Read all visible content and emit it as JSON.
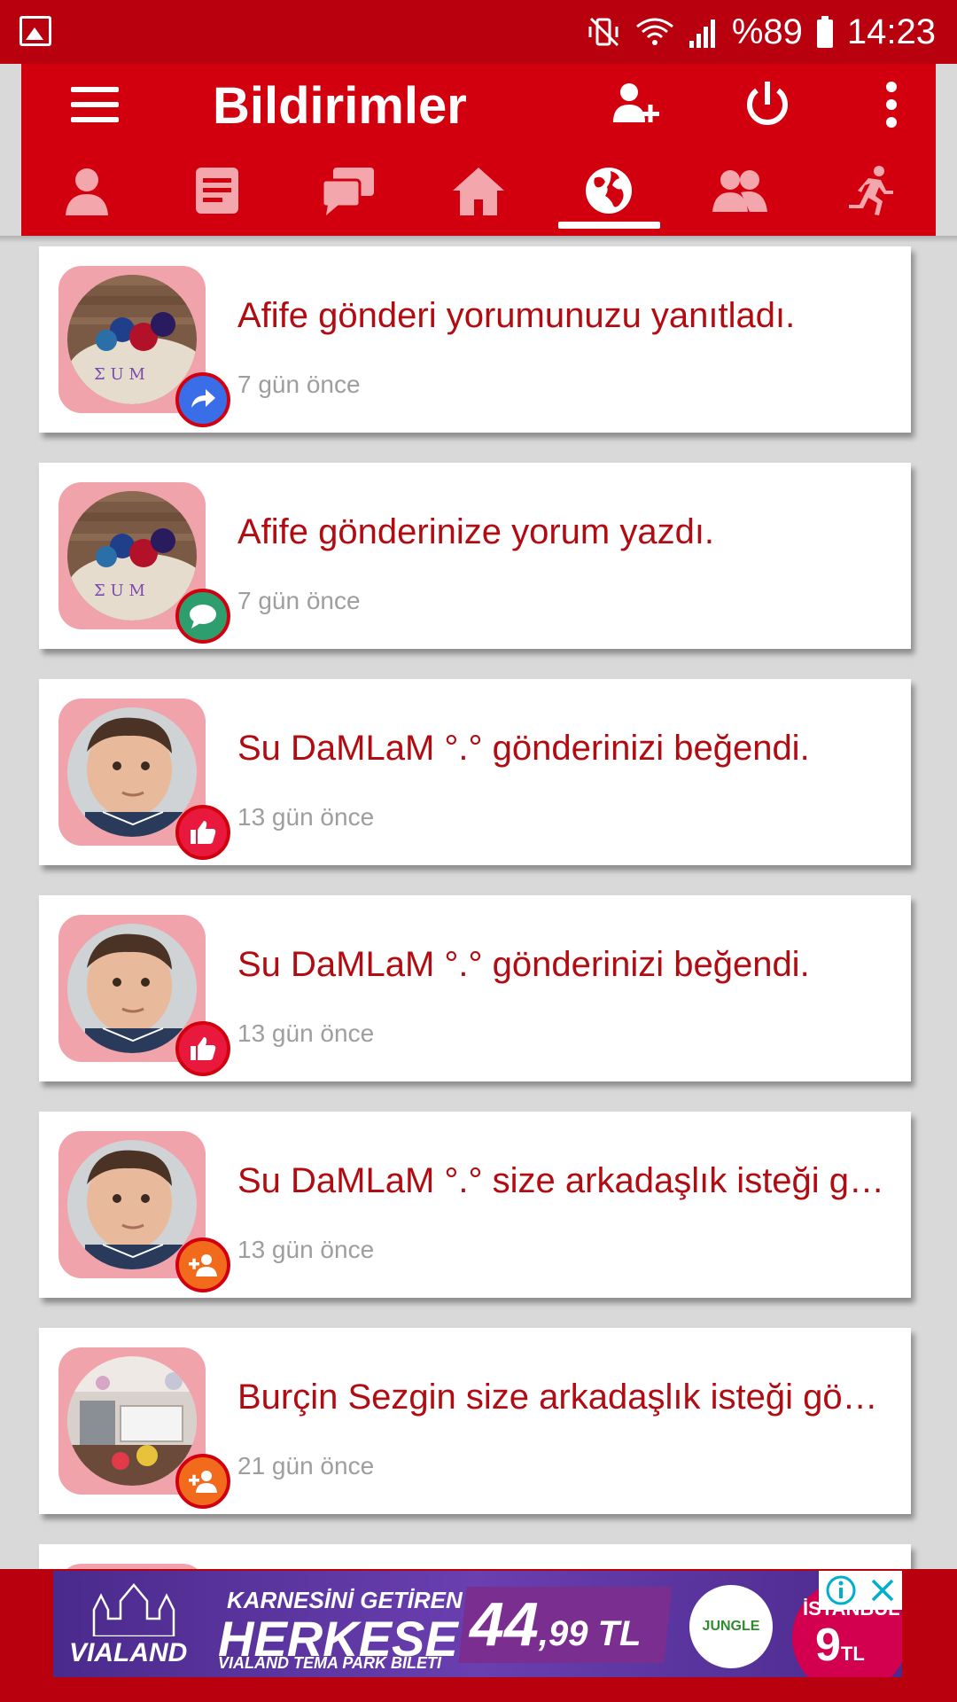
{
  "status_bar": {
    "battery": "%89",
    "time": "14:23"
  },
  "toolbar": {
    "title": "Bildirimler"
  },
  "tabs": [
    {
      "name": "profile",
      "active": false
    },
    {
      "name": "posts",
      "active": false
    },
    {
      "name": "messages",
      "active": false
    },
    {
      "name": "home",
      "active": false
    },
    {
      "name": "explore",
      "active": true
    },
    {
      "name": "friends",
      "active": false
    },
    {
      "name": "activity",
      "active": false
    }
  ],
  "notifications": [
    {
      "message": "Afife gönderi yorumunuzu yanıtladı.",
      "time": "7 gün önce",
      "badge": "reply-icon",
      "badge_color": "#3a6ee8"
    },
    {
      "message": "Afife gönderinize yorum yazdı.",
      "time": "7 gün önce",
      "badge": "comment-icon",
      "badge_color": "#2f9e6e"
    },
    {
      "message": "Su DaMLaM °.° gönderinizi beğendi.",
      "time": "13 gün önce",
      "badge": "like-icon",
      "badge_color": "#e8193c"
    },
    {
      "message": "Su DaMLaM °.° gönderinizi beğendi.",
      "time": "13 gün önce",
      "badge": "like-icon",
      "badge_color": "#e8193c"
    },
    {
      "message": "Su DaMLaM °.° size arkadaşlık isteği gönderdi.",
      "time": "13 gün önce",
      "badge": "add-friend-icon",
      "badge_color": "#f26b1d"
    },
    {
      "message": "Burçin Sezgin size arkadaşlık isteği gönderdi.",
      "time": "21 gün önce",
      "badge": "add-friend-icon",
      "badge_color": "#f26b1d"
    }
  ],
  "ad": {
    "brand": "VIALAND",
    "line1": "KARNESİNİ GETİREN",
    "line2": "HERKESE",
    "line3": "VIALAND TEMA PARK BİLETİ",
    "price": "44",
    "price_decimal": ",99 TL",
    "jungle": "JUNGLE",
    "istanbul": "İSTANBUL",
    "istanbul_price": "9",
    "istanbul_currency": "TL"
  },
  "colors": {
    "primary": "#d2000f",
    "dark_primary": "#b8000f",
    "text_red": "#b10c12",
    "time_gray": "#9e9e9e"
  }
}
